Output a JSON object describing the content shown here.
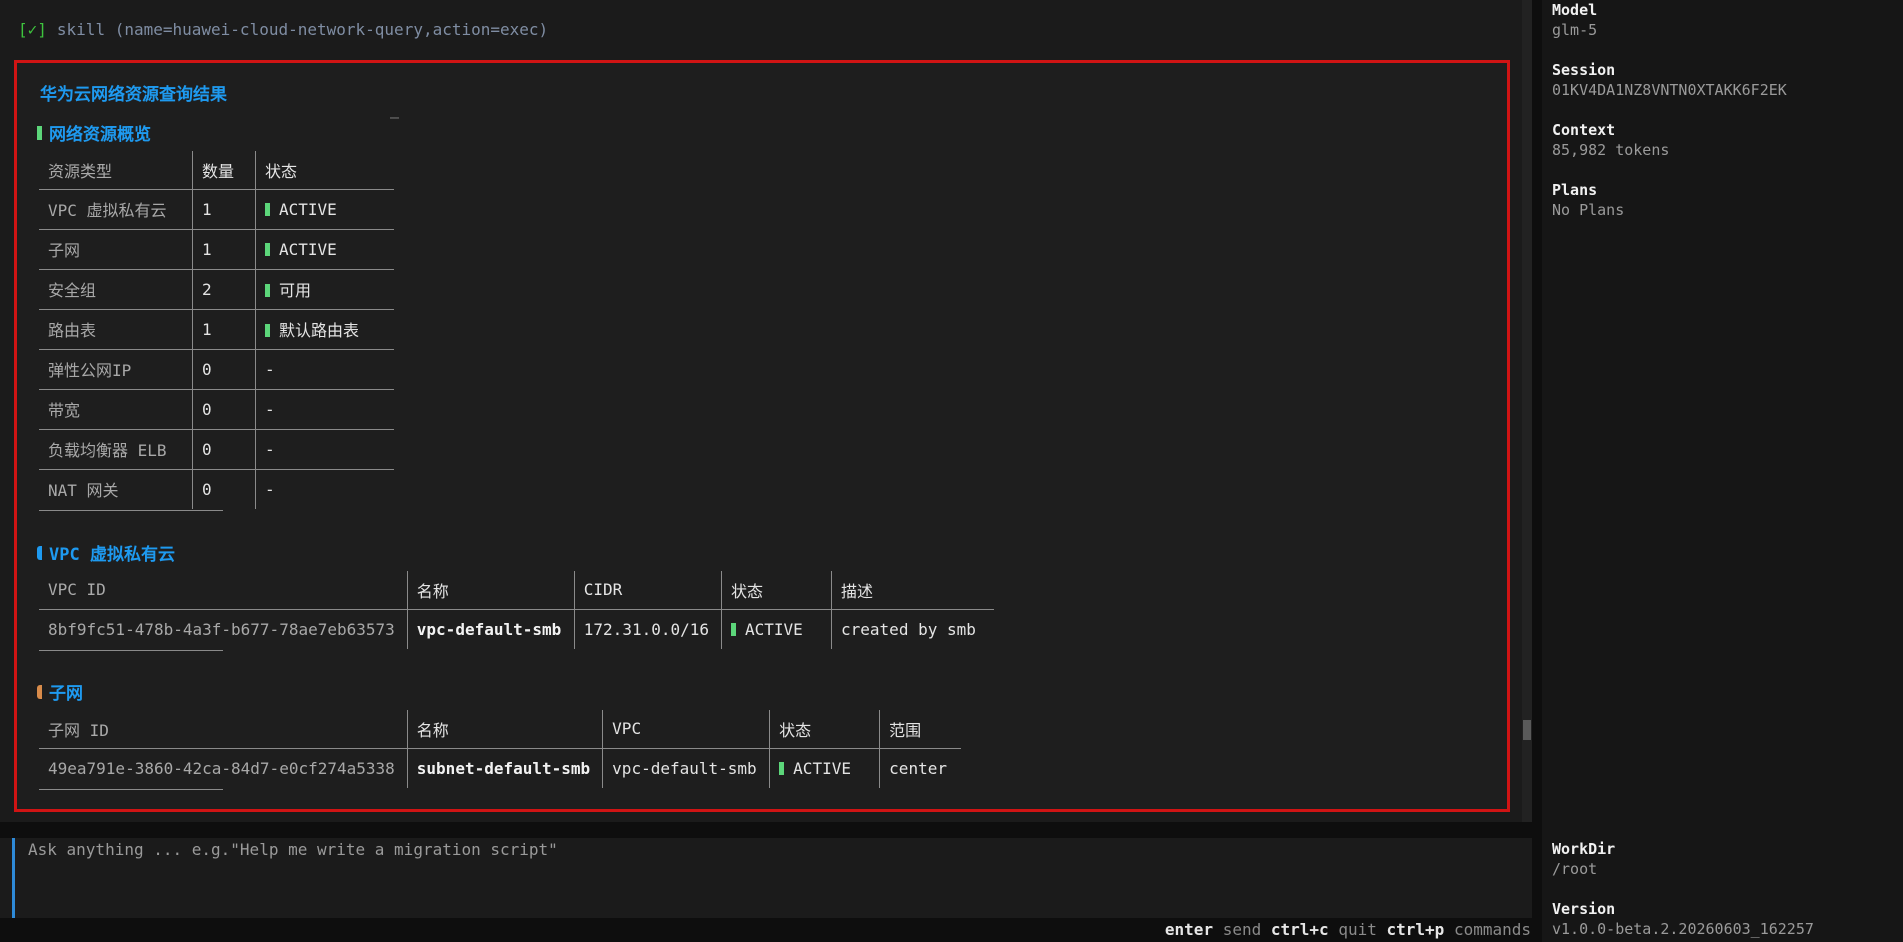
{
  "skill": {
    "check": "[✓]",
    "text": "skill (name=huawei-cloud-network-query,action=exec)"
  },
  "result": {
    "title": "华为云网络资源查询结果",
    "overview": {
      "title": "网络资源概览",
      "collapse": "—",
      "headers": [
        "资源类型",
        "数量",
        "状态"
      ],
      "rows": [
        {
          "type": "VPC 虚拟私有云",
          "count": "1",
          "status": "ACTIVE",
          "dot": true
        },
        {
          "type": "子网",
          "count": "1",
          "status": "ACTIVE",
          "dot": true
        },
        {
          "type": "安全组",
          "count": "2",
          "status": "可用",
          "dot": true
        },
        {
          "type": "路由表",
          "count": "1",
          "status": "默认路由表",
          "dot": true
        },
        {
          "type": "弹性公网IP",
          "count": "0",
          "status": "-",
          "dot": false
        },
        {
          "type": "带宽",
          "count": "0",
          "status": "-",
          "dot": false
        },
        {
          "type": "负载均衡器 ELB",
          "count": "0",
          "status": "-",
          "dot": false
        },
        {
          "type": "NAT 网关",
          "count": "0",
          "status": "-",
          "dot": false
        }
      ]
    },
    "vpc": {
      "title": "VPC 虚拟私有云",
      "headers": [
        "VPC ID",
        "名称",
        "CIDR",
        "状态",
        "描述"
      ],
      "row": {
        "id": "8bf9fc51-478b-4a3f-b677-78ae7eb63573",
        "name": "vpc-default-smb",
        "cidr": "172.31.0.0/16",
        "status": "ACTIVE",
        "desc": "created by smb"
      }
    },
    "subnet": {
      "title": "子网",
      "headers": [
        "子网 ID",
        "名称",
        "VPC",
        "状态",
        "范围"
      ],
      "row": {
        "id": "49ea791e-3860-42ca-84d7-e0cf274a5338",
        "name": "subnet-default-smb",
        "vpc": "vpc-default-smb",
        "status": "ACTIVE",
        "scope": "center"
      }
    }
  },
  "input": {
    "placeholder": "Ask anything ... e.g.\"Help me write a migration script\""
  },
  "hints": [
    {
      "key": "enter",
      "label": "send"
    },
    {
      "key": "ctrl+c",
      "label": "quit"
    },
    {
      "key": "ctrl+p",
      "label": "commands"
    }
  ],
  "sidebar": {
    "model": {
      "label": "Model",
      "value": "glm-5"
    },
    "session": {
      "label": "Session",
      "value": "01KV4DA1NZ8VNTN0XTAKK6F2EK"
    },
    "context": {
      "label": "Context",
      "value": "85,982 tokens"
    },
    "plans": {
      "label": "Plans",
      "value": "No Plans"
    },
    "workdir": {
      "label": "WorkDir",
      "value": "/root"
    },
    "version": {
      "label": "Version",
      "value": "v1.0.0-beta.2.20260603_162257"
    }
  },
  "colors": {
    "accent": "#1e9af0",
    "highlight_border": "#d01414",
    "status_dot": "#5cd67a",
    "input_border": "#2e8ad8"
  }
}
